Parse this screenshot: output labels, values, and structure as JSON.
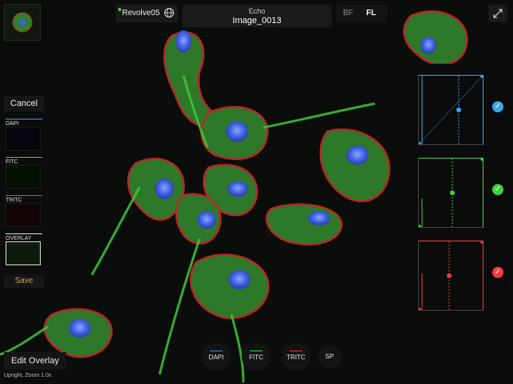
{
  "device": {
    "name": "Revolve05",
    "status_color": "#3fd23f",
    "icon": "globe-icon"
  },
  "header": {
    "app": "Echo",
    "image_name": "Image_0013"
  },
  "modes": {
    "bf": "BF",
    "fl": "FL",
    "active": "FL"
  },
  "expand_icon": "expand-arrows-icon",
  "left_panel": {
    "cancel": "Cancel",
    "channels": [
      {
        "label": "DAPI",
        "color": "#4a8cff"
      },
      {
        "label": "FITC",
        "color": "#3fd23f"
      },
      {
        "label": "TRITC",
        "color": "#ff3b3b"
      },
      {
        "label": "OVERLAY",
        "color": "#e0e0e0"
      }
    ],
    "save": "Save"
  },
  "histograms": [
    {
      "channel": "DAPI",
      "color": "#3aa8e8",
      "enabled": true
    },
    {
      "channel": "FITC",
      "color": "#3fd23f",
      "enabled": true
    },
    {
      "channel": "TRITC",
      "color": "#ff3b3b",
      "enabled": true
    }
  ],
  "bottom": {
    "edit_overlay": "Edit Overlay",
    "status": "Upright, Zoom 1.0x",
    "channel_buttons": [
      {
        "label": "DAPI",
        "color": "#4a8cff"
      },
      {
        "label": "FITC",
        "color": "#3fd23f"
      },
      {
        "label": "TRITC",
        "color": "#ff3b3b"
      },
      {
        "label": "SP",
        "color": ""
      }
    ]
  }
}
